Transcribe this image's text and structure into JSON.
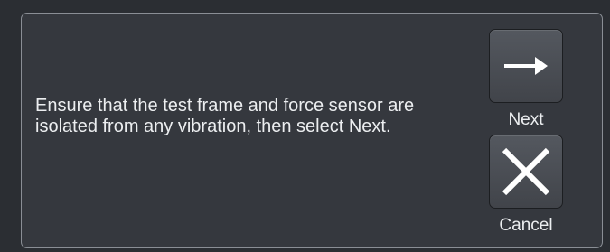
{
  "dialog": {
    "message": "Ensure that the test frame and force sensor are isolated from any vibration, then select Next.",
    "next_label": "Next",
    "cancel_label": "Cancel",
    "next_icon": "arrow-right-icon",
    "cancel_icon": "close-x-icon"
  },
  "colors": {
    "background": "#2b2e33",
    "panel": "#35383e",
    "panel_border": "#8a8e95",
    "button": "#4b4f55",
    "text": "#eceef0"
  }
}
